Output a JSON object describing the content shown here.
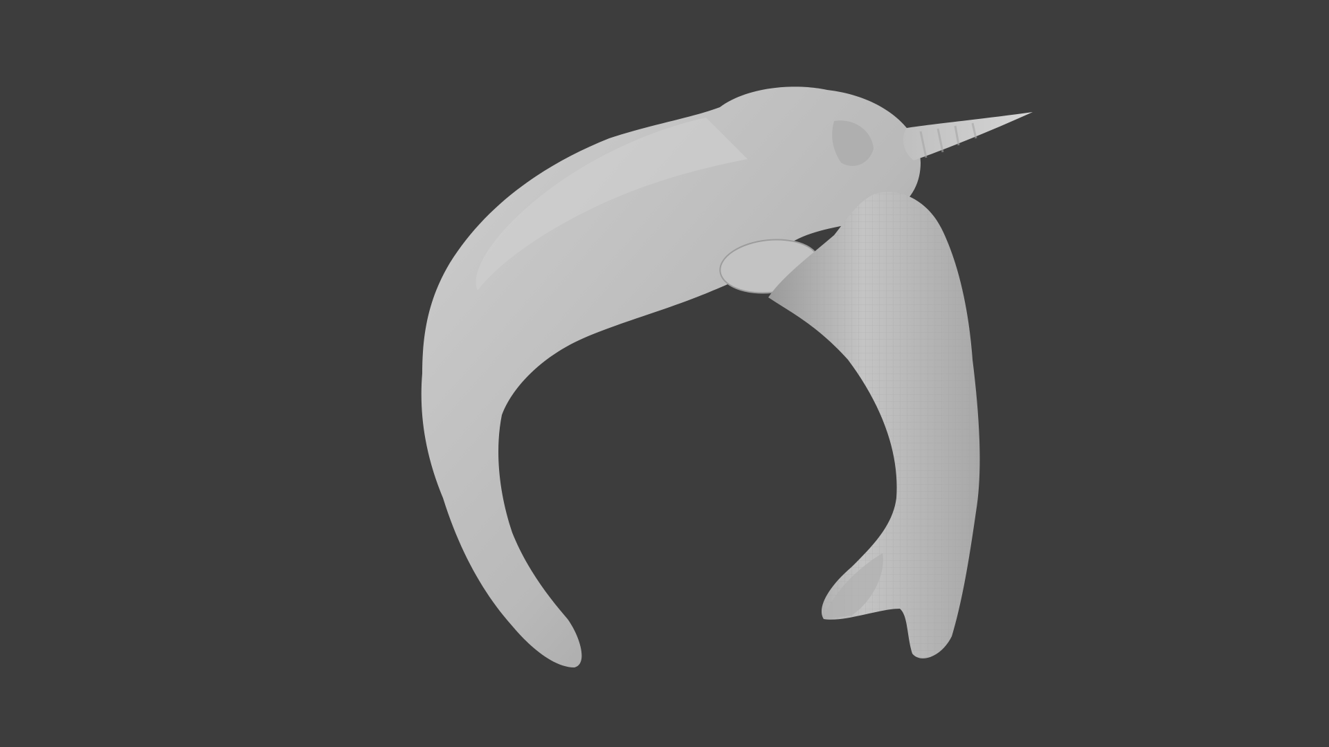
{
  "viewport": {
    "background_color": "#3d3d3d",
    "object": "narwhal-sculpt",
    "object_color": "#bdbdbd"
  }
}
